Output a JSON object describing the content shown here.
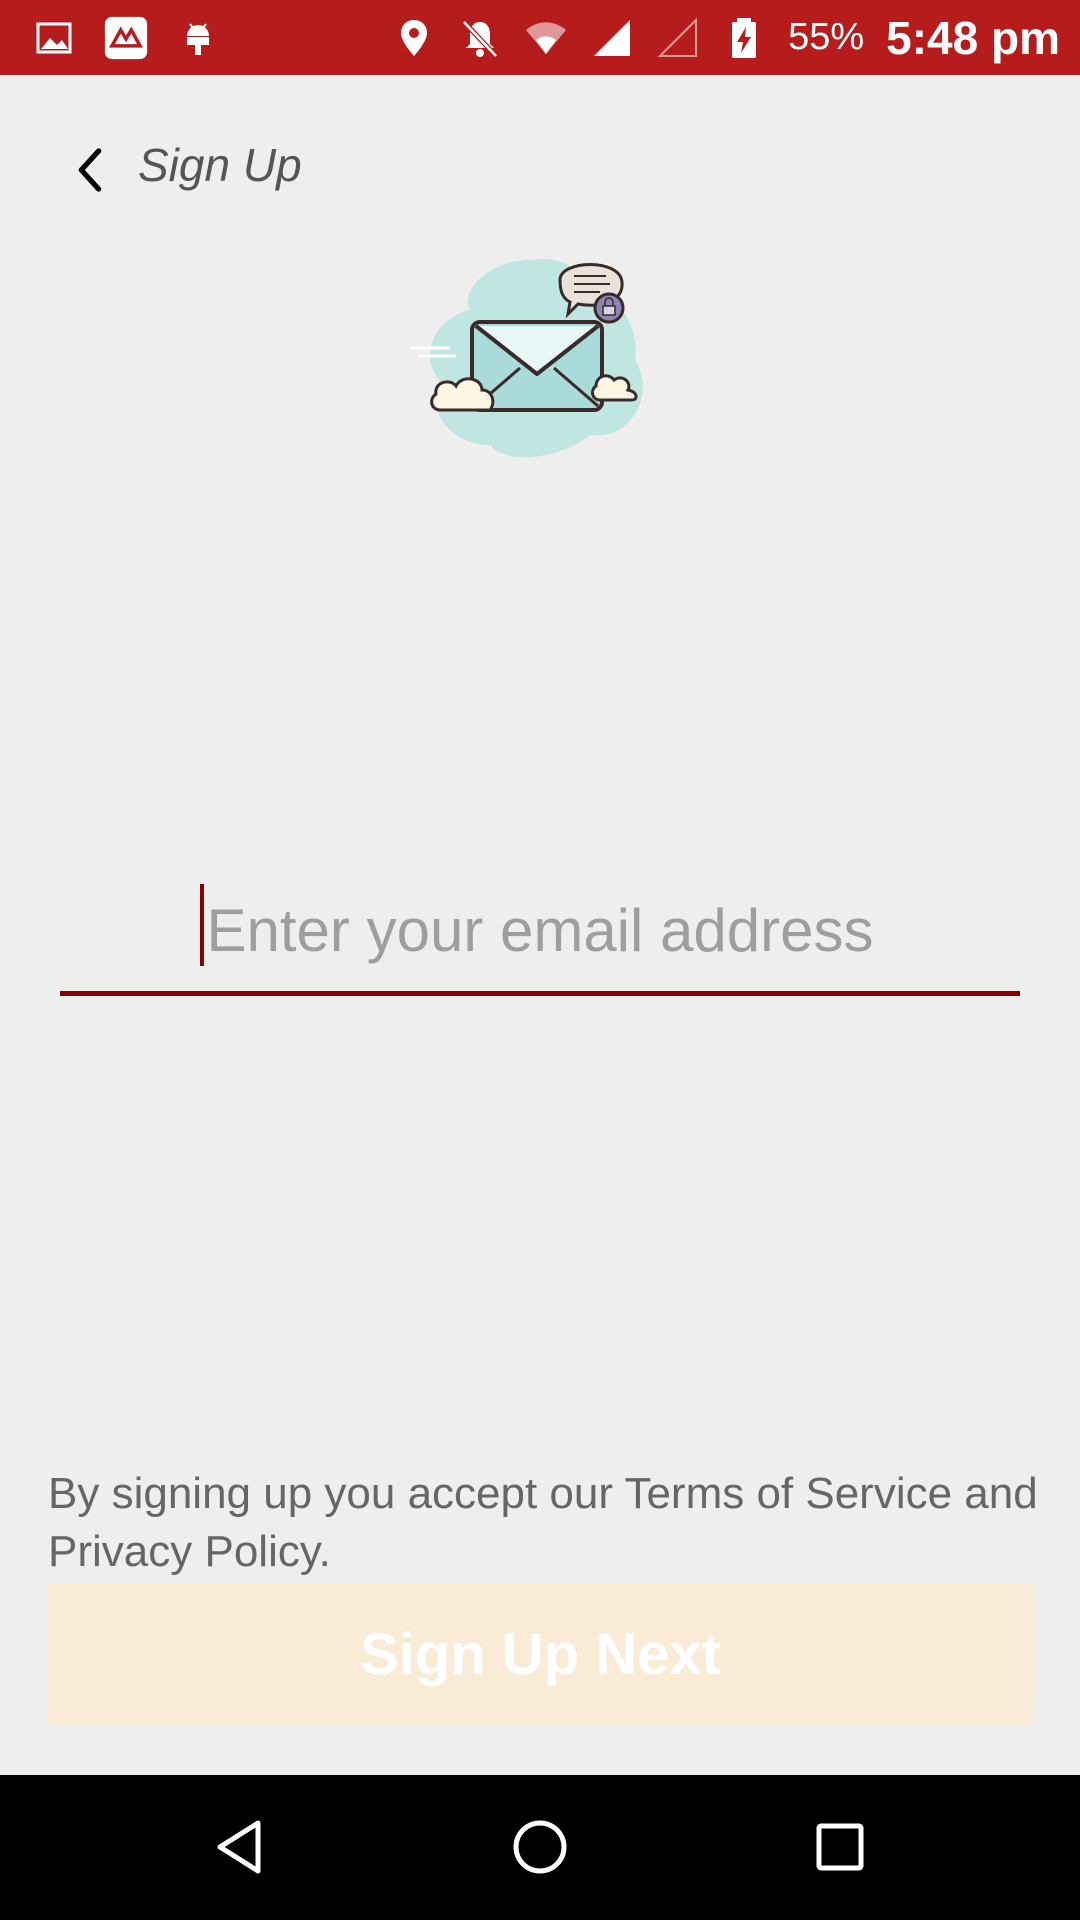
{
  "status_bar": {
    "battery_percent": "55%",
    "time": "5:48 pm",
    "icons": [
      "image-icon",
      "app-logo-icon",
      "android-debug-icon",
      "location-icon",
      "bell-off-icon",
      "wifi-icon",
      "cell-signal-icon",
      "cell-signal-empty-icon",
      "battery-charging-icon"
    ],
    "color": "#b71c1c"
  },
  "header": {
    "title": "Sign Up",
    "back_icon": "chevron-left-icon"
  },
  "illustration": {
    "icon": "envelope-chat-lock-icon"
  },
  "email": {
    "placeholder": "Enter your email address",
    "value": "",
    "accent_color": "#8b0000"
  },
  "terms": {
    "text": "By signing up you accept our Terms of Service and Privacy Policy."
  },
  "next_button": {
    "label": "Sign Up Next",
    "background": "#faebd7"
  },
  "nav_bar": {
    "icons": [
      "back-triangle-icon",
      "home-circle-icon",
      "recents-square-icon"
    ]
  }
}
